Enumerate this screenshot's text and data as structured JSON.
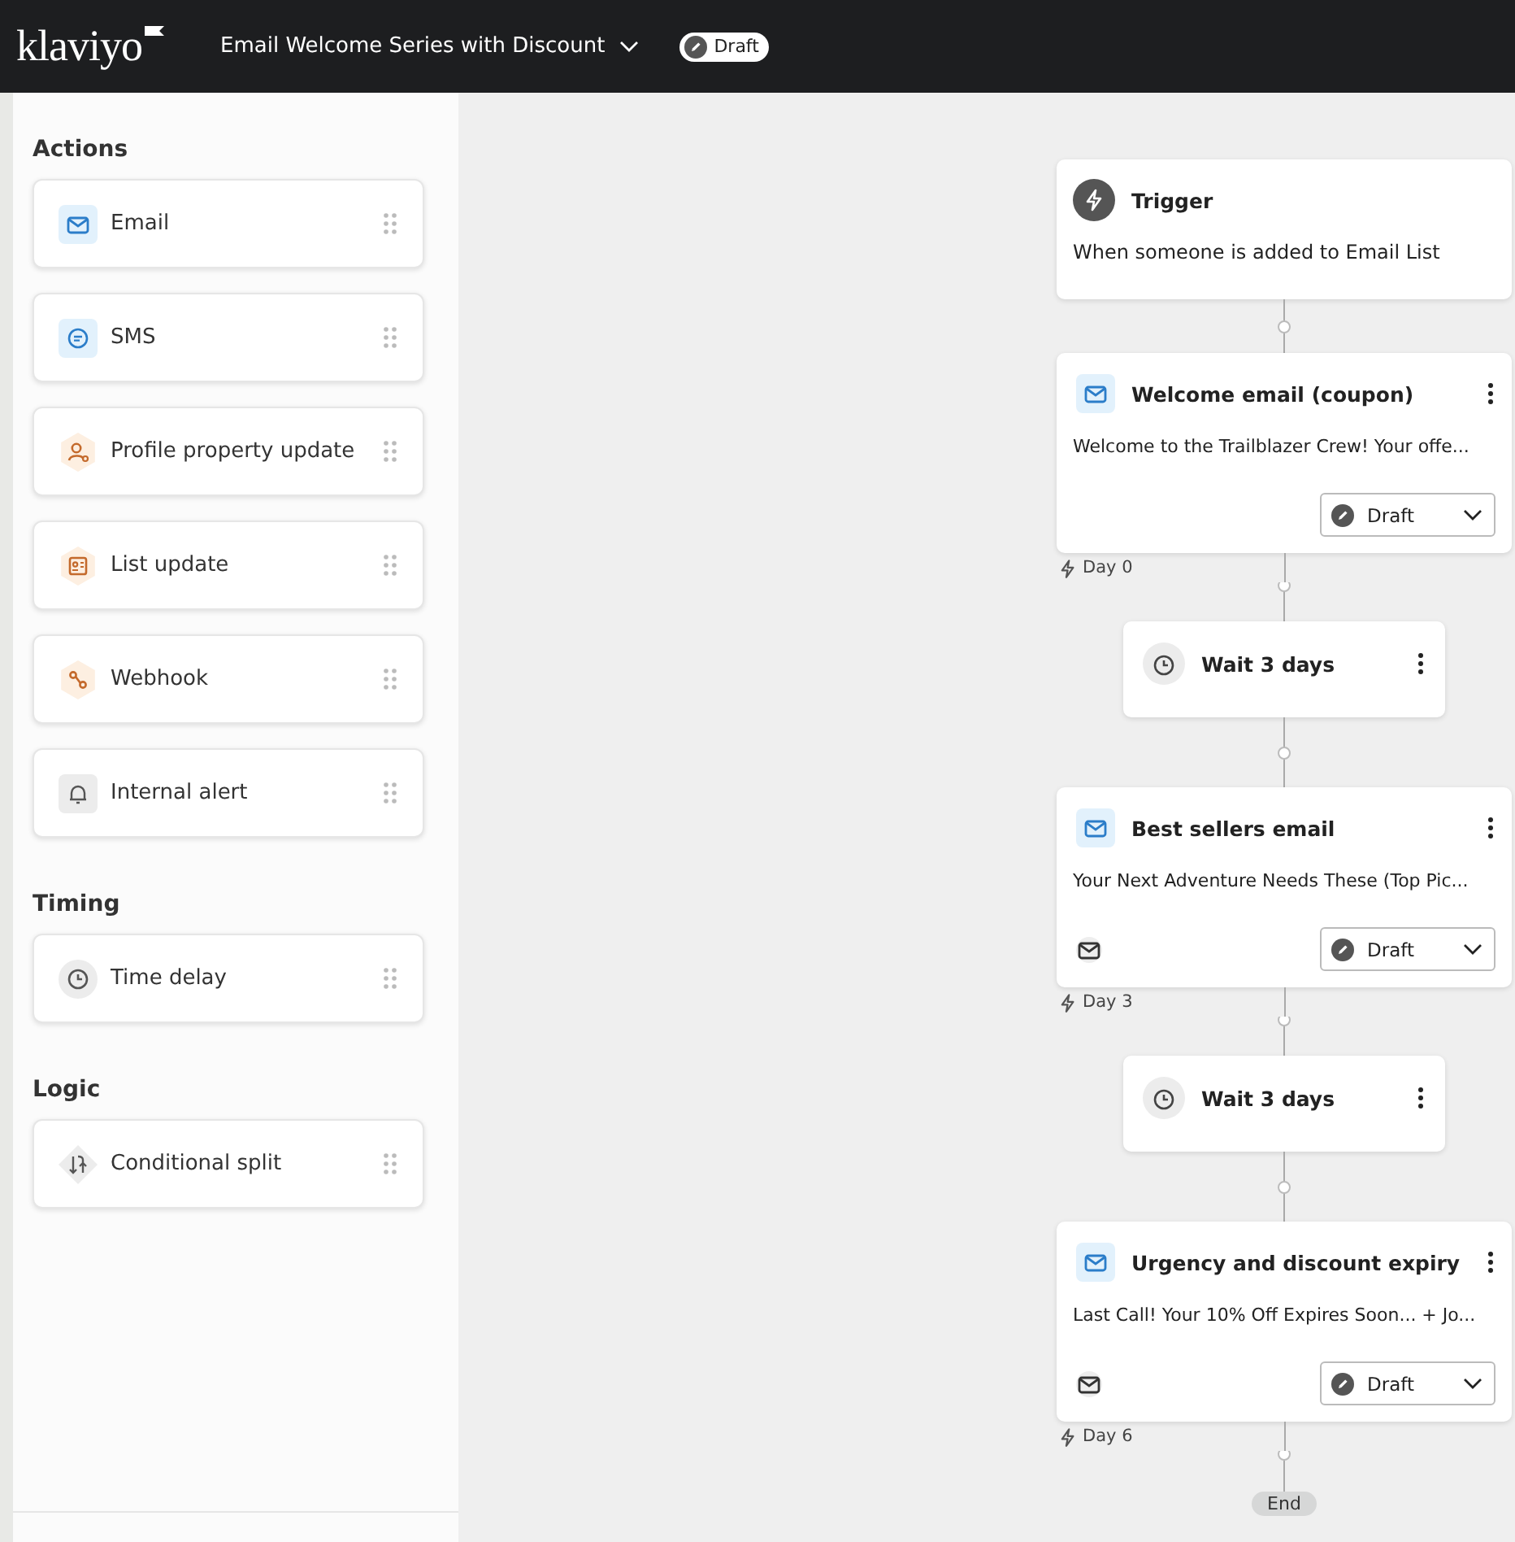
{
  "topbar": {
    "logo": "klaviyo",
    "flow_title": "Email Welcome Series with Discount",
    "status": "Draft"
  },
  "sidebar": {
    "sections": [
      {
        "title": "Actions",
        "items": [
          {
            "label": "Email",
            "kind": "email"
          },
          {
            "label": "SMS",
            "kind": "sms"
          },
          {
            "label": "Profile property update",
            "kind": "profile"
          },
          {
            "label": "List update",
            "kind": "list"
          },
          {
            "label": "Webhook",
            "kind": "webhook"
          },
          {
            "label": "Internal alert",
            "kind": "alert"
          }
        ]
      },
      {
        "title": "Timing",
        "items": [
          {
            "label": "Time delay",
            "kind": "delay"
          }
        ]
      },
      {
        "title": "Logic",
        "items": [
          {
            "label": "Conditional split",
            "kind": "split"
          }
        ]
      }
    ]
  },
  "flow": {
    "nodes": [
      {
        "kind": "trigger",
        "title": "Trigger",
        "description": "When someone is added to Email List"
      },
      {
        "kind": "email",
        "title": "Welcome email (coupon)",
        "subject": "Welcome to the Trailblazer Crew! Your offe...",
        "status": "Draft",
        "footer_icon": false,
        "day": "Day 0"
      },
      {
        "kind": "wait",
        "title": "Wait 3 days"
      },
      {
        "kind": "email",
        "title": "Best sellers email",
        "subject": "Your Next Adventure Needs These (Top Pic...",
        "status": "Draft",
        "footer_icon": true,
        "day": "Day 3"
      },
      {
        "kind": "wait",
        "title": "Wait 3 days"
      },
      {
        "kind": "email",
        "title": "Urgency and discount expiry",
        "subject": "Last Call! Your 10% Off Expires Soon... + Jo...",
        "status": "Draft",
        "footer_icon": true,
        "day": "Day 6"
      },
      {
        "kind": "end",
        "title": "End"
      }
    ]
  }
}
